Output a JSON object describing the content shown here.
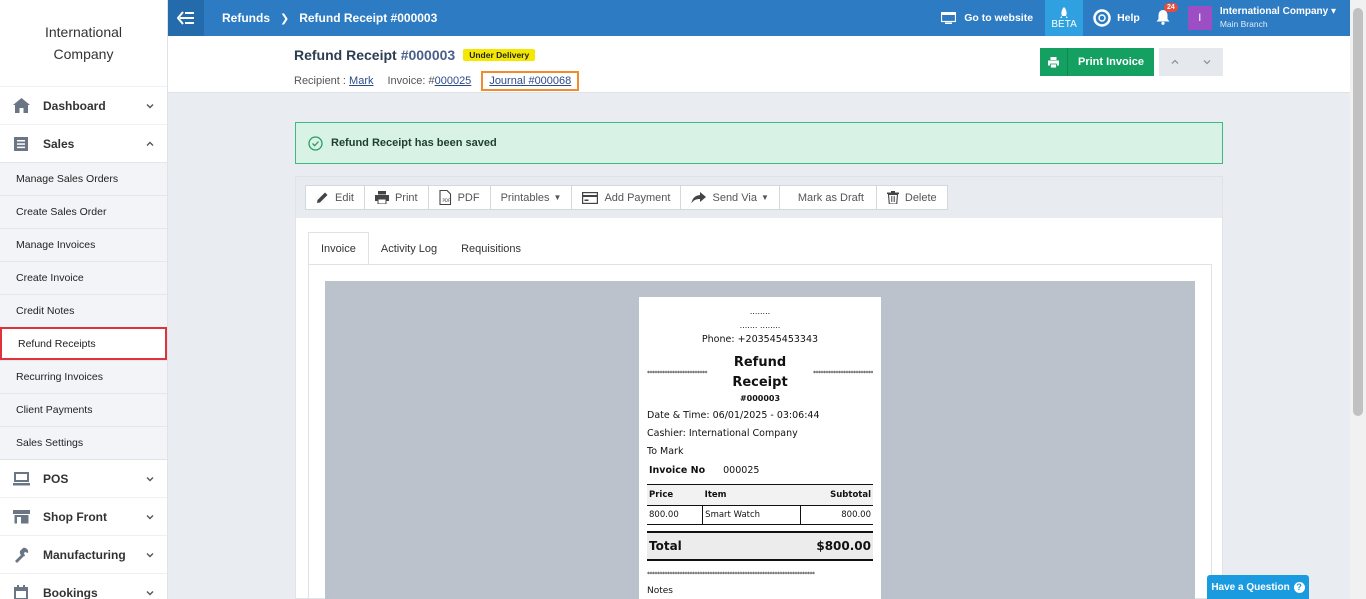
{
  "sidebar": {
    "brand": "International Company",
    "items": [
      {
        "label": "Dashboard"
      },
      {
        "label": "Sales"
      },
      {
        "label": "POS"
      },
      {
        "label": "Shop Front"
      },
      {
        "label": "Manufacturing"
      },
      {
        "label": "Bookings"
      }
    ],
    "sales_sub": [
      "Manage Sales Orders",
      "Create Sales Order",
      "Manage Invoices",
      "Create Invoice",
      "Credit Notes",
      "Refund Receipts",
      "Recurring Invoices",
      "Client Payments",
      "Sales Settings"
    ]
  },
  "topbar": {
    "crumb_parent": "Refunds",
    "crumb_current": "Refund Receipt #000003",
    "go_website": "Go to website",
    "beta": "BETA",
    "help": "Help",
    "notif_count": "24",
    "avatar_letter": "I",
    "user_name": "International Company",
    "branch": "Main Branch"
  },
  "header": {
    "title": "Refund Receipt",
    "number": "#000003",
    "status": "Under Delivery",
    "recipient_label": "Recipient :",
    "recipient": "Mark",
    "invoice_label": "Invoice: #",
    "invoice": "000025",
    "journal": "Journal #000068",
    "print_label": "Print Invoice"
  },
  "alert": {
    "text": "Refund Receipt has been saved"
  },
  "toolbar": {
    "edit": "Edit",
    "print": "Print",
    "pdf": "PDF",
    "printables": "Printables",
    "add_payment": "Add Payment",
    "send_via": "Send Via",
    "mark_draft": "Mark as Draft",
    "delete": "Delete"
  },
  "tabs": [
    "Invoice",
    "Activity Log",
    "Requisitions"
  ],
  "receipt": {
    "dots1": "........",
    "dots2": "....... ........",
    "phone": "Phone: +203545453343",
    "stars": "************************",
    "title_line1": "Refund",
    "title_line2": "Receipt",
    "number": "#000003",
    "datetime": "Date & Time: 06/01/2025 - 03:06:44",
    "cashier": "Cashier: International Company",
    "to": "To Mark",
    "invoice_no_label": "Invoice No",
    "invoice_no": "000025",
    "col_price": "Price",
    "col_item": "Item",
    "col_subtotal": "Subtotal",
    "row_price": "800.00",
    "row_item": "Smart Watch",
    "row_subtotal": "800.00",
    "total_label": "Total",
    "total_value": "$800.00",
    "stars_long": "*******************************************************************",
    "notes": "Notes"
  },
  "help_widget": {
    "label": "Have a Question",
    "q": "?"
  },
  "colors": {
    "topbar": "#2d7bc2",
    "print_button": "#14a060",
    "alert_bg": "#d8f3e6",
    "status_badge": "#f5e800",
    "active_outline": "#e0323c",
    "journal_outline": "#f08c2e"
  }
}
